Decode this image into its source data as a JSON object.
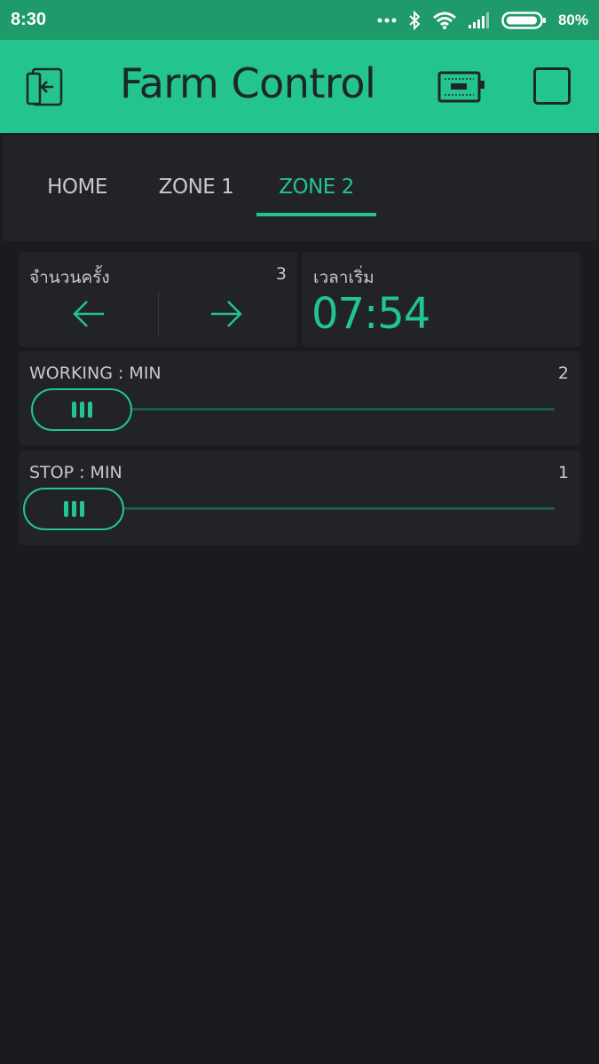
{
  "status_bar": {
    "time": "8:30",
    "battery": "80%",
    "icons": [
      "dots-icon",
      "bluetooth-icon",
      "wifi-icon",
      "signal-icon",
      "battery-icon"
    ]
  },
  "header": {
    "title": "Farm Control",
    "icons": [
      "exit-icon",
      "device-icon",
      "stop-square-icon"
    ]
  },
  "tabs": [
    {
      "label": "HOME",
      "active": false
    },
    {
      "label": "ZONE 1",
      "active": false
    },
    {
      "label": "ZONE 2",
      "active": true
    }
  ],
  "step_widget": {
    "label": "จำนวนครั้ง",
    "value": "3",
    "icons": [
      "arrow-left-icon",
      "arrow-right-icon"
    ]
  },
  "time_widget": {
    "label": "เวลาเริ่ม",
    "value": "07:54"
  },
  "working_slider": {
    "label": "WORKING : MIN",
    "value": "2"
  },
  "stop_slider": {
    "label": "STOP : MIN",
    "value": "1"
  },
  "colors": {
    "accent": "#23c48e",
    "header_bg": "#23c48e",
    "status_bg": "#1f9a6b",
    "background": "#1a1b20",
    "panel": "#222329"
  }
}
